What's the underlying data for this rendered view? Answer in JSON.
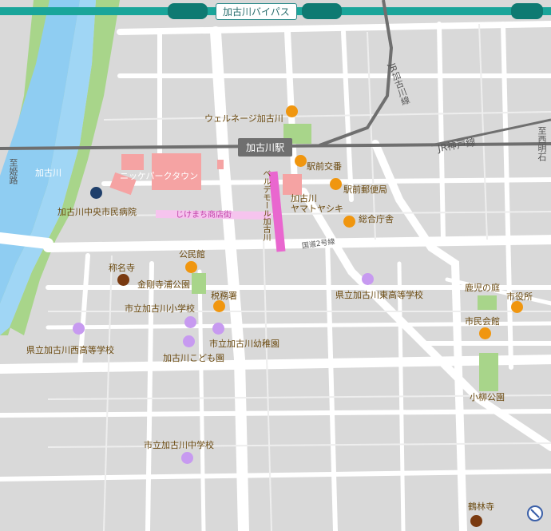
{
  "colors": {
    "orange": "#f0960f",
    "purple": "#c79af0",
    "brown": "#7a3a10",
    "navy": "#1f3f6b",
    "park": "#a8d58a",
    "river": "#a0d6f5",
    "pink_road": "#e967cf",
    "light_pink": "#f6c4ee",
    "building": "#f5a3a3"
  },
  "labels": {
    "bypass": "加古川バイパス",
    "station": "加古川駅",
    "jr_kakogawa_line": "JR加古川線",
    "jr_kobe_line": "JR神戸線",
    "to_himeji": "至姫路",
    "to_nishiakashi": "至西明石",
    "river": "加古川",
    "welnej": "ウェルネージ加古川",
    "ekimae_koban": "駅前交番",
    "ekimae_post": "駅前郵便局",
    "yamatoyashiki": "加古川\nヤマトヤシキ",
    "sogo_chosha": "総合庁舎",
    "nikke_park_town": "ニッケパークタウン",
    "hospital": "加古川中央市民病院",
    "jikemachi": "じけまち商店街",
    "belle_mall": "ベルデモール加古川",
    "route2": "国道2号線",
    "kominkan": "公民館",
    "shomyoji": "称名寺",
    "kongoji_park": "金剛寺浦公園",
    "zeimusho": "税務署",
    "higashi_hs": "県立加古川東高等学校",
    "kako_elem": "市立加古川小学校",
    "kako_kinder": "市立加古川幼稚園",
    "nishi_hs": "県立加古川西高等学校",
    "kodomoen": "加古川こども園",
    "kagononiwa": "鹿児の庭",
    "shiyakusho": "市役所",
    "shimin_kaikan": "市民会館",
    "koyagi_park": "小柳公園",
    "kako_jhs": "市立加古川中学校",
    "kakurinji": "鶴林寺"
  }
}
